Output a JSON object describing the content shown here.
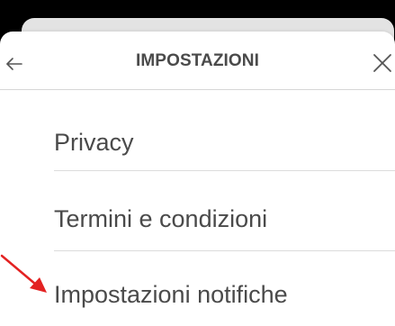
{
  "header": {
    "title": "IMPOSTAZIONI",
    "back_icon": "arrow-left-icon",
    "close_icon": "close-icon"
  },
  "menu": {
    "items": [
      {
        "label": "Privacy"
      },
      {
        "label": "Termini e condizioni"
      },
      {
        "label": "Impostazioni notifiche"
      }
    ]
  },
  "annotation": {
    "arrow_color": "#e32222"
  },
  "colors": {
    "text": "#4a4a4a",
    "top_bar": "#000000",
    "back_sheet": "#e3e3e3"
  }
}
